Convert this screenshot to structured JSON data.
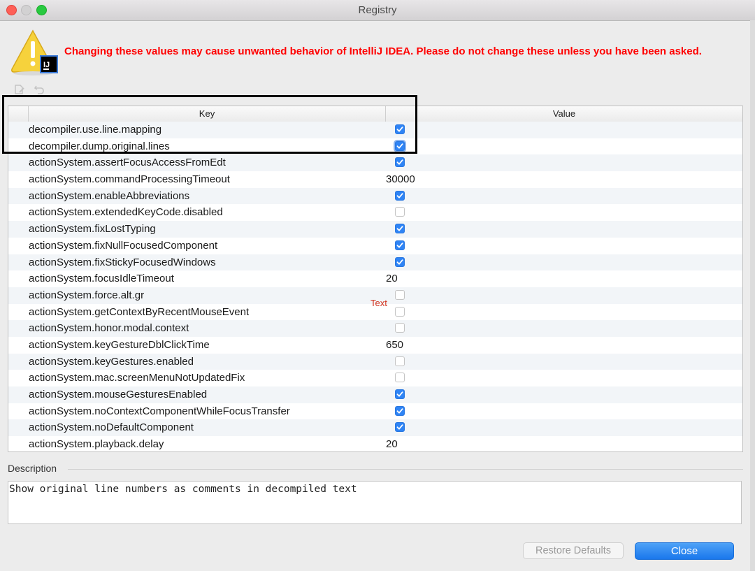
{
  "window": {
    "title": "Registry"
  },
  "warning": {
    "text": "Changing these values may cause unwanted behavior of IntelliJ IDEA. Please do not change these unless you have been asked.",
    "color": "#ff0000"
  },
  "toolbar": {
    "edit_icon": "edit-icon",
    "revert_icon": "revert-icon"
  },
  "table": {
    "columns": [
      "Key",
      "Value"
    ],
    "rows": [
      {
        "key": "decompiler.use.line.mapping",
        "type": "bool",
        "value": true
      },
      {
        "key": "decompiler.dump.original.lines",
        "type": "bool",
        "value": true,
        "focused": true
      },
      {
        "key": "actionSystem.assertFocusAccessFromEdt",
        "type": "bool",
        "value": true
      },
      {
        "key": "actionSystem.commandProcessingTimeout",
        "type": "text",
        "value": "30000"
      },
      {
        "key": "actionSystem.enableAbbreviations",
        "type": "bool",
        "value": true
      },
      {
        "key": "actionSystem.extendedKeyCode.disabled",
        "type": "bool",
        "value": false
      },
      {
        "key": "actionSystem.fixLostTyping",
        "type": "bool",
        "value": true
      },
      {
        "key": "actionSystem.fixNullFocusedComponent",
        "type": "bool",
        "value": true
      },
      {
        "key": "actionSystem.fixStickyFocusedWindows",
        "type": "bool",
        "value": true
      },
      {
        "key": "actionSystem.focusIdleTimeout",
        "type": "text",
        "value": "20"
      },
      {
        "key": "actionSystem.force.alt.gr",
        "type": "bool",
        "value": false
      },
      {
        "key": "actionSystem.getContextByRecentMouseEvent",
        "type": "bool",
        "value": false
      },
      {
        "key": "actionSystem.honor.modal.context",
        "type": "bool",
        "value": false
      },
      {
        "key": "actionSystem.keyGestureDblClickTime",
        "type": "text",
        "value": "650"
      },
      {
        "key": "actionSystem.keyGestures.enabled",
        "type": "bool",
        "value": false
      },
      {
        "key": "actionSystem.mac.screenMenuNotUpdatedFix",
        "type": "bool",
        "value": false
      },
      {
        "key": "actionSystem.mouseGesturesEnabled",
        "type": "bool",
        "value": true
      },
      {
        "key": "actionSystem.noContextComponentWhileFocusTransfer",
        "type": "bool",
        "value": true
      },
      {
        "key": "actionSystem.noDefaultComponent",
        "type": "bool",
        "value": true
      },
      {
        "key": "actionSystem.playback.delay",
        "type": "text",
        "value": "20"
      }
    ]
  },
  "annotation": {
    "text": "Text",
    "color": "#d2331f"
  },
  "description": {
    "label": "Description",
    "text": "Show original line numbers as comments in decompiled text"
  },
  "buttons": {
    "restore": "Restore Defaults",
    "close": "Close"
  },
  "colors": {
    "accent": "#2f84f5",
    "alt_row": "#f2f5f8"
  }
}
